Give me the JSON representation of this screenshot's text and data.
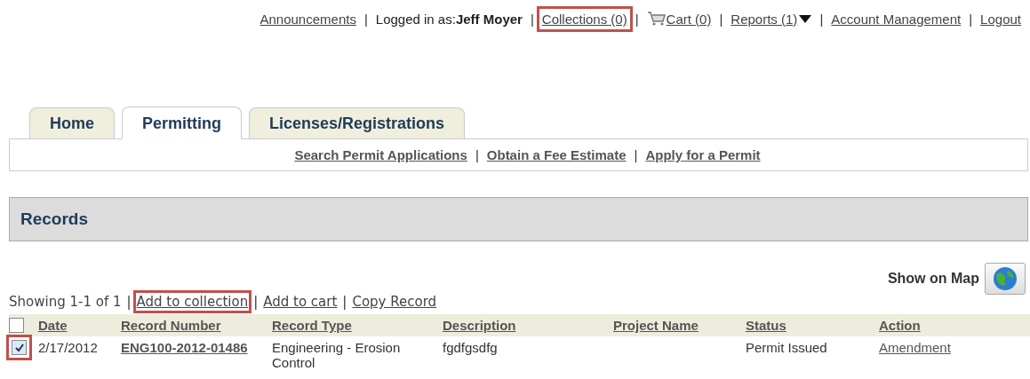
{
  "top_links": [
    {
      "kind": "link",
      "text": "Announcements",
      "highlighted": false
    },
    {
      "kind": "user",
      "separator": "|",
      "label": "Logged in as:",
      "name": "Jeff Moyer"
    },
    {
      "kind": "link",
      "separator": "|",
      "text": "Collections (0)",
      "highlighted": true
    },
    {
      "kind": "cart",
      "separator": "|",
      "text": "Cart (0)",
      "highlighted": false
    },
    {
      "kind": "menu",
      "separator": "|",
      "text": "Reports (1)",
      "highlighted": false
    },
    {
      "kind": "link",
      "separator": "|",
      "text": "Account Management",
      "highlighted": false
    },
    {
      "kind": "link",
      "separator": "|",
      "text": "Logout",
      "highlighted": false
    }
  ],
  "tabs": [
    {
      "label": "Home",
      "selected": false
    },
    {
      "label": "Permitting",
      "selected": true
    },
    {
      "label": "Licenses/Registrations",
      "selected": false
    }
  ],
  "sub_links": [
    {
      "text": "Search Permit Applications"
    },
    {
      "separator": "|",
      "text": "Obtain a Fee Estimate"
    },
    {
      "separator": "|",
      "text": "Apply for a Permit"
    }
  ],
  "section_title": "Records",
  "show_on_map": "Show on Map",
  "result_bar": {
    "count": "Showing 1-1 of 1",
    "actions": [
      {
        "separator": "|",
        "text": "Add to collection",
        "highlighted": true
      },
      {
        "separator": "|",
        "text": "Add to cart",
        "highlighted": false
      },
      {
        "separator": "|",
        "text": "Copy Record",
        "highlighted": false
      }
    ]
  },
  "table": {
    "select_all": {
      "checked": false
    },
    "columns": [
      "Date",
      "Record Number",
      "Record Type",
      "Description",
      "Project Name",
      "Status",
      "Action"
    ],
    "rows": [
      {
        "checked": true,
        "highlighted": true,
        "date": "2/17/2012",
        "record_number": "ENG100-2012-01486",
        "record_type": "Engineering - Erosion Control",
        "description": "fgdfgsdfg",
        "status": "Permit Issued",
        "action": "Amendment"
      }
    ]
  }
}
